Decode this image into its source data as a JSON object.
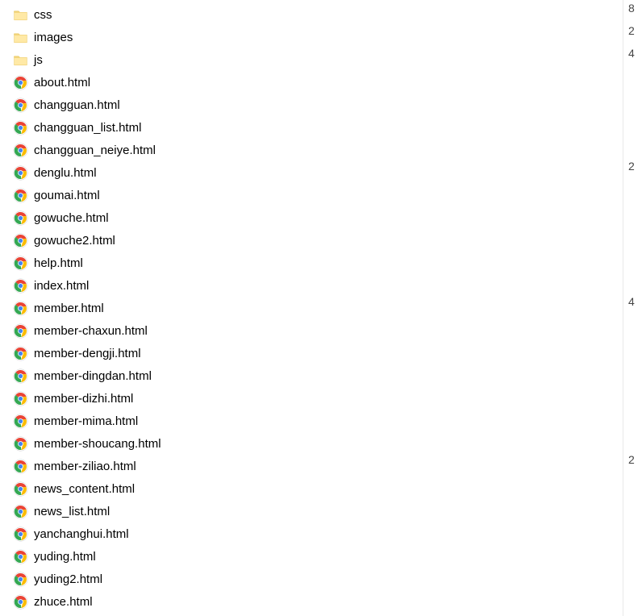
{
  "items": [
    {
      "type": "folder",
      "name": "css"
    },
    {
      "type": "folder",
      "name": "images"
    },
    {
      "type": "folder",
      "name": "js"
    },
    {
      "type": "chrome",
      "name": "about.html"
    },
    {
      "type": "chrome",
      "name": "changguan.html"
    },
    {
      "type": "chrome",
      "name": "changguan_list.html"
    },
    {
      "type": "chrome",
      "name": "changguan_neiye.html"
    },
    {
      "type": "chrome",
      "name": "denglu.html"
    },
    {
      "type": "chrome",
      "name": "goumai.html"
    },
    {
      "type": "chrome",
      "name": "gowuche.html"
    },
    {
      "type": "chrome",
      "name": "gowuche2.html"
    },
    {
      "type": "chrome",
      "name": "help.html"
    },
    {
      "type": "chrome",
      "name": "index.html"
    },
    {
      "type": "chrome",
      "name": "member.html"
    },
    {
      "type": "chrome",
      "name": "member-chaxun.html"
    },
    {
      "type": "chrome",
      "name": "member-dengji.html"
    },
    {
      "type": "chrome",
      "name": "member-dingdan.html"
    },
    {
      "type": "chrome",
      "name": "member-dizhi.html"
    },
    {
      "type": "chrome",
      "name": "member-mima.html"
    },
    {
      "type": "chrome",
      "name": "member-shoucang.html"
    },
    {
      "type": "chrome",
      "name": "member-ziliao.html"
    },
    {
      "type": "chrome",
      "name": "news_content.html"
    },
    {
      "type": "chrome",
      "name": "news_list.html"
    },
    {
      "type": "chrome",
      "name": "yanchanghui.html"
    },
    {
      "type": "chrome",
      "name": "yuding.html"
    },
    {
      "type": "chrome",
      "name": "yuding2.html"
    },
    {
      "type": "chrome",
      "name": "zhuce.html"
    }
  ],
  "rightEdge": [
    "8",
    "2",
    "4",
    "",
    "",
    "",
    "",
    "2",
    "",
    "",
    "",
    "",
    "",
    "4",
    "",
    "",
    "",
    "",
    "",
    "",
    "2"
  ]
}
